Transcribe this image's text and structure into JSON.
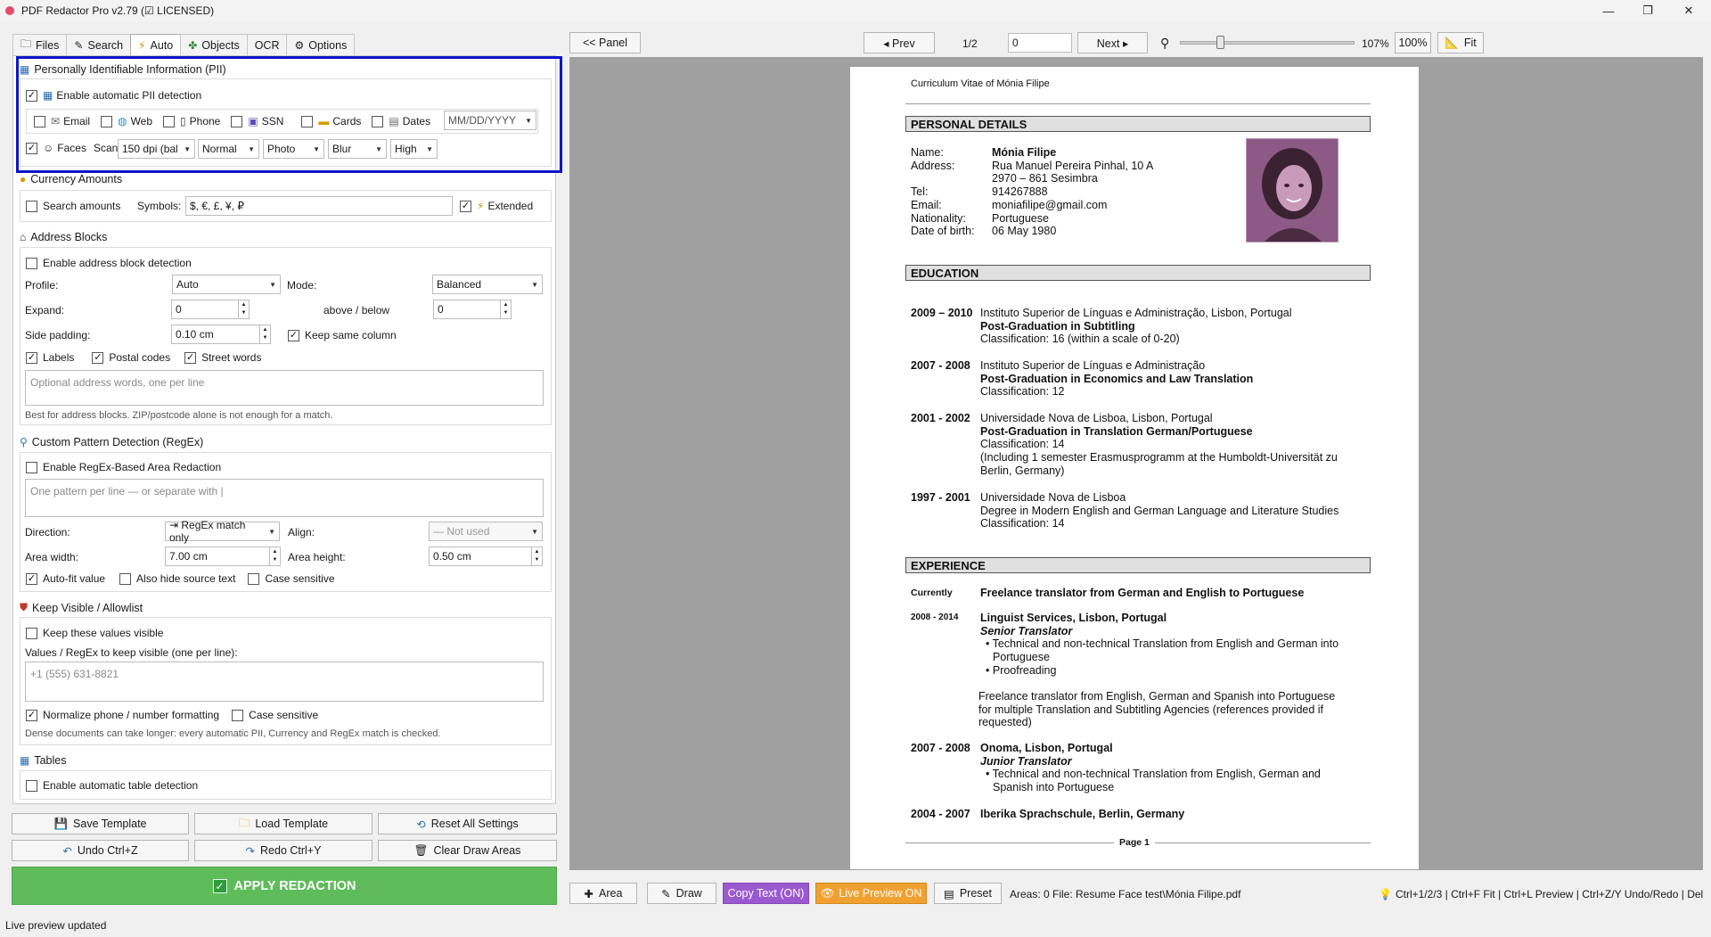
{
  "window": {
    "title": "PDF Redactor Pro v2.79 (☑ LICENSED)",
    "controls": [
      "—",
      "❐",
      "✕"
    ]
  },
  "tabs": [
    {
      "label": "Files",
      "icon": "folder-icon"
    },
    {
      "label": "Search",
      "icon": "pencil-icon"
    },
    {
      "label": "Auto",
      "icon": "lightning-icon",
      "active": true
    },
    {
      "label": "Objects",
      "icon": "puzzle-icon"
    },
    {
      "label": "OCR",
      "icon": ""
    },
    {
      "label": "Options",
      "icon": "gear-icon"
    }
  ],
  "pii": {
    "title": "Personally Identifiable Information (PII)",
    "enable_label": "Enable automatic PII detection",
    "enabled": true,
    "types": [
      {
        "label": "Email",
        "checked": false
      },
      {
        "label": "Web",
        "checked": false
      },
      {
        "label": "Phone",
        "checked": false
      },
      {
        "label": "SSN",
        "checked": false
      },
      {
        "label": "Cards",
        "checked": false
      },
      {
        "label": "Dates",
        "checked": false
      }
    ],
    "date_format": "MM/DD/YYYY",
    "faces_label": "Faces",
    "faces_checked": true,
    "scan_label": "Scan:",
    "scan_value": "150 dpi (bal",
    "mode_value": "Normal",
    "type_value": "Photo",
    "effect_value": "Blur",
    "strength_value": "High"
  },
  "currency": {
    "title": "Currency Amounts",
    "search_label": "Search amounts",
    "search_checked": false,
    "symbols_label": "Symbols:",
    "symbols_value": "$, €, £, ¥, ₽",
    "extended_label": "Extended",
    "extended_checked": true
  },
  "address": {
    "title": "Address Blocks",
    "enable_label": "Enable address block detection",
    "profile_label": "Profile:",
    "profile_value": "Auto",
    "mode_label": "Mode:",
    "mode_value": "Balanced",
    "expand_label": "Expand:",
    "expand_value": "0",
    "above_below_label": "above / below",
    "above_below_value": "0",
    "side_padding_label": "Side padding:",
    "side_padding_value": "0.10 cm",
    "keep_column_label": "Keep same column",
    "labels_label": "Labels",
    "postal_label": "Postal codes",
    "street_label": "Street words",
    "words_placeholder": "Optional address words, one per line",
    "hint": "Best for address blocks. ZIP/postcode alone is not enough for a match."
  },
  "regex": {
    "title": "Custom Pattern Detection (RegEx)",
    "enable_label": "Enable RegEx-Based Area Redaction",
    "pattern_placeholder": "One pattern per line  —  or separate with |",
    "direction_label": "Direction:",
    "direction_value": "⇥ RegEx match only",
    "align_label": "Align:",
    "align_value": "— Not used",
    "width_label": "Area width:",
    "width_value": "7.00 cm",
    "height_label": "Area height:",
    "height_value": "0.50 cm",
    "autofit_label": "Auto-fit value",
    "hide_source_label": "Also hide source text",
    "case_label": "Case sensitive"
  },
  "allowlist": {
    "title": "Keep Visible / Allowlist",
    "keep_label": "Keep these values visible",
    "values_label": "Values / RegEx to keep visible (one per line):",
    "values_placeholder": "+1 (555) 631-8821",
    "normalize_label": "Normalize phone / number formatting",
    "case_label": "Case sensitive",
    "hint": "Dense documents can take longer: every automatic PII, Currency and RegEx match is checked."
  },
  "tables": {
    "title": "Tables",
    "enable_label": "Enable automatic table detection"
  },
  "buttons": {
    "save_template": "Save Template",
    "load_template": "Load Template",
    "reset_all": "Reset All Settings",
    "undo": "Undo  Ctrl+Z",
    "redo": "Redo  Ctrl+Y",
    "clear_draw": "Clear Draw Areas",
    "apply": "APPLY REDACTION"
  },
  "status": "Live preview updated",
  "toolbar": {
    "panel": "<< Panel",
    "prev": "◂ Prev",
    "page_indicator": "1/2",
    "page_input": "0",
    "next": "Next ▸",
    "zoom_value": "107%",
    "zoom_100": "100%",
    "fit": "Fit"
  },
  "bottom": {
    "area": "Area",
    "draw": "Draw",
    "copy_text": "Copy Text (ON)",
    "live_preview": "Live Preview ON",
    "preset": "Preset",
    "areas_count": "Areas: 0",
    "file": "File: Resume Face test\\Mónia Filipe.pdf",
    "shortcuts": "Ctrl+1/2/3 | Ctrl+F Fit | Ctrl+L Preview | Ctrl+Z/Y Undo/Redo | Del"
  },
  "colors": {
    "accent_green": "#5ebd5a",
    "copy_purple": "#9b59d0",
    "live_orange": "#f0a030",
    "highlight_blue": "#0a15c8"
  },
  "cv": {
    "top_title": "Curriculum Vitae of Mónia Filipe",
    "personal_header": "PERSONAL DETAILS",
    "personal_labels": [
      "Name:",
      "Address:",
      "",
      "Tel:",
      "Email:",
      "Nationality:",
      "Date of birth:"
    ],
    "personal_values": [
      "Mónia Filipe",
      "Rua Manuel Pereira Pinhal, 10 A",
      "2970 – 861 Sesimbra",
      "914267888",
      "moniafilipe@gmail.com",
      "Portuguese",
      "06 May 1980"
    ],
    "education_header": "EDUCATION",
    "education": [
      {
        "years": "2009 – 2010",
        "lines": [
          "Instituto Superior de Línguas e Administração, Lisbon, Portugal",
          "Post-Graduation in Subtitling",
          "Classification: 16 (within a scale of 0-20)"
        ]
      },
      {
        "years": "2007 - 2008",
        "lines": [
          "Instituto Superior de Línguas e Administração",
          "Post-Graduation in Economics and Law Translation",
          "Classification: 12"
        ]
      },
      {
        "years": "2001 - 2002",
        "lines": [
          "Universidade Nova de Lisboa, Lisbon, Portugal",
          "Post-Graduation in Translation German/Portuguese",
          "Classification: 14",
          "(Including 1 semester Erasmusprogramm at the Humboldt-Universität zu",
          "Berlin, Germany)"
        ]
      },
      {
        "years": "1997 - 2001",
        "lines": [
          "Universidade Nova de Lisboa",
          "Degree in Modern English and German Language and Literature Studies",
          "Classification: 14"
        ]
      }
    ],
    "experience_header": "EXPERIENCE",
    "exp_currently_label": "Currently",
    "exp_currently_text": "Freelance translator from German and English to Portuguese",
    "exp_2008_years": "2008 - 2014",
    "exp_2008_company": "Linguist Services, Lisbon, Portugal",
    "exp_2008_role": "Senior Translator",
    "exp_2008_bullets": [
      "Technical and non-technical Translation from English and German into",
      "Portuguese",
      "Proofreading"
    ],
    "exp_freelance_lines": [
      "Freelance translator from English, German and Spanish into Portuguese",
      "for multiple Translation and Subtitling Agencies (references provided if",
      "requested)"
    ],
    "exp_2007_years": "2007 - 2008",
    "exp_2007_company": "Onoma, Lisbon, Portugal",
    "exp_2007_role": "Junior Translator",
    "exp_2007_bullets": [
      "Technical and non-technical Translation from English, German and",
      "Spanish into Portuguese"
    ],
    "exp_2004_years": "2004 - 2007",
    "exp_2004_company": "Iberika Sprachschule, Berlin, Germany",
    "footer": "Page 1"
  }
}
